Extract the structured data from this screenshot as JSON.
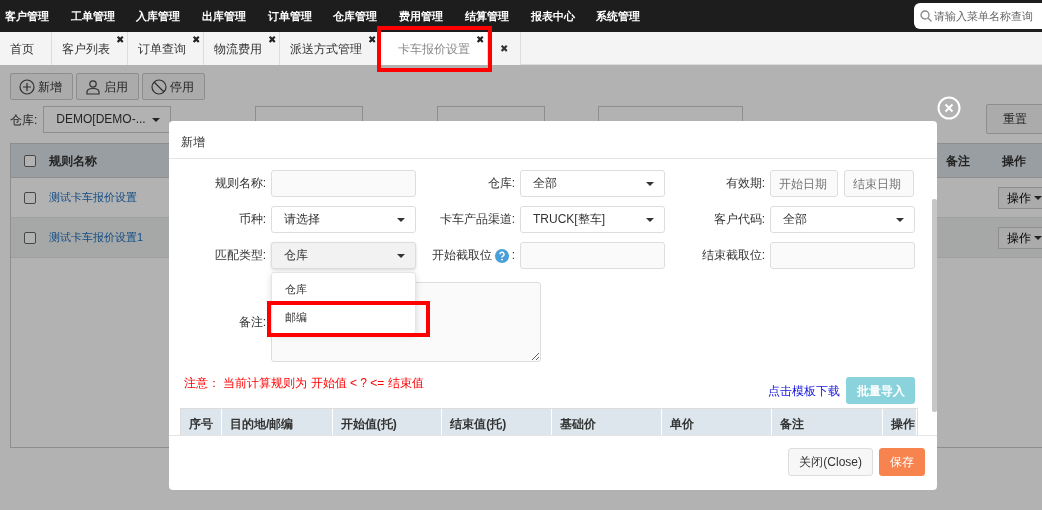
{
  "top_nav": {
    "items": [
      "客户管理",
      "工单管理",
      "入库管理",
      "出库管理",
      "订单管理",
      "仓库管理",
      "费用管理",
      "结算管理",
      "报表中心",
      "系统管理"
    ]
  },
  "search": {
    "placeholder": "请输入菜单名称查询"
  },
  "tabs": [
    {
      "label": "首页",
      "selected": false,
      "closable": false,
      "highlighted": false
    },
    {
      "label": "客户列表",
      "selected": false,
      "closable": true,
      "highlighted": false
    },
    {
      "label": "订单查询",
      "selected": false,
      "closable": true,
      "highlighted": false
    },
    {
      "label": "物流费用",
      "selected": false,
      "closable": true,
      "highlighted": false
    },
    {
      "label": "派送方式管理",
      "selected": false,
      "closable": true,
      "highlighted": false
    },
    {
      "label": "卡车报价设置",
      "selected": true,
      "closable": true,
      "highlighted": true
    }
  ],
  "tab_close_glyph": "✖",
  "toolbar": [
    {
      "label": "新增",
      "kind": "add"
    },
    {
      "label": "启用",
      "kind": "enable"
    },
    {
      "label": "停用",
      "kind": "disable"
    }
  ],
  "filter": {
    "label": "仓库:",
    "value": "DEMO[DEMO-..."
  },
  "reset_button": "重置",
  "table": {
    "all_checked": false,
    "columns": [
      "规则名称",
      "备注",
      "操作"
    ],
    "rows": [
      {
        "name": "测试卡车报价设置",
        "checked": false,
        "hovered": false,
        "action": "操作"
      },
      {
        "name": "测试卡车报价设置1",
        "checked": false,
        "hovered": true,
        "action": "操作"
      }
    ]
  },
  "modal": {
    "title": "新增",
    "fields": [
      {
        "kind": "text",
        "label": "规则名称:",
        "help": false
      },
      {
        "kind": "select",
        "label": "仓库:",
        "value": "全部",
        "help": false
      },
      {
        "kind": "daterange",
        "label": "有效期:",
        "placeholder": "开始日期",
        "placeholder_end": "结束日期",
        "help": false
      },
      {
        "kind": "select",
        "label": "币种:",
        "value": "请选择",
        "help": false
      },
      {
        "kind": "select",
        "label": "卡车产品渠道:",
        "value": "TRUCK[整车]",
        "help": false
      },
      {
        "kind": "select",
        "label": "客户代码:",
        "value": "全部",
        "help": false
      },
      {
        "kind": "select",
        "label": "匹配类型:",
        "value": "仓库",
        "help": false,
        "expanded": true,
        "options": [
          {
            "label": "仓库",
            "highlighted": false
          },
          {
            "label": "邮编",
            "highlighted": true
          }
        ]
      },
      {
        "kind": "text",
        "label": "开始截取位",
        "label_suffix": ":",
        "help": true
      },
      {
        "kind": "text",
        "label": "结束截取位:",
        "help": false
      }
    ],
    "remark_label": "备注:",
    "notice": "注意： 当前计算规则为 开始值 < ? <= 结束值",
    "template_link": "点击模板下载",
    "import_button": {
      "label": "批量导入",
      "disabled": true
    },
    "detail_columns": [
      "序号",
      "目的地/邮编",
      "开始值(托)",
      "结束值(托)",
      "基础价",
      "单价",
      "备注",
      "操作"
    ],
    "buttons": [
      {
        "label": "关闭(Close)",
        "kind": "secondary"
      },
      {
        "label": "保存",
        "kind": "primary"
      }
    ]
  }
}
